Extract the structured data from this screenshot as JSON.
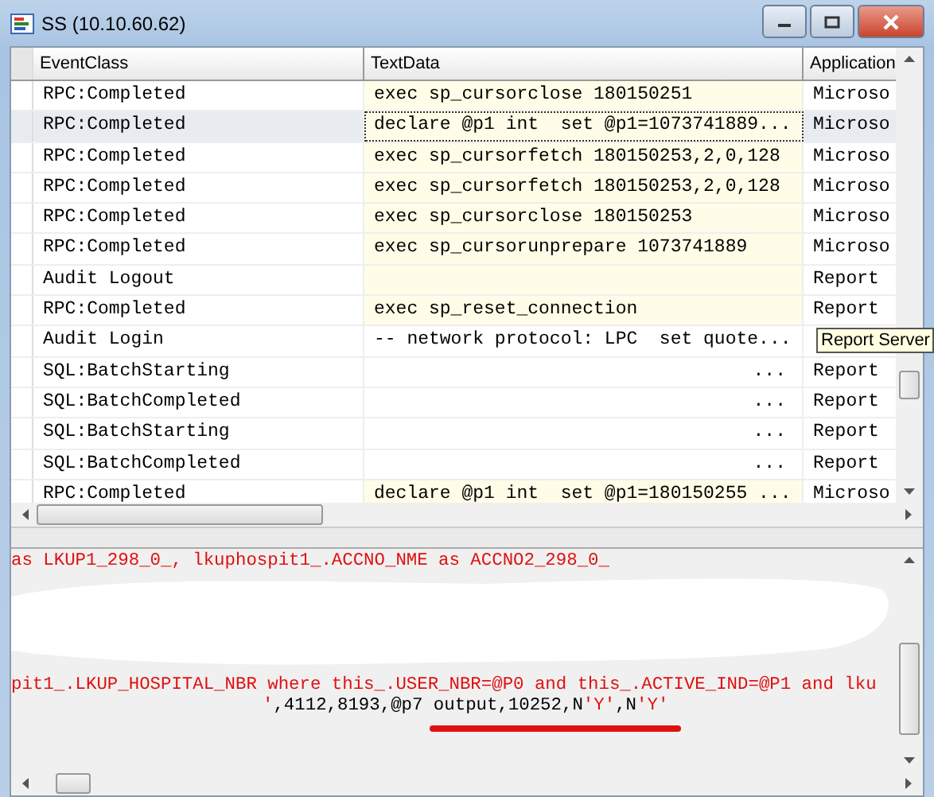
{
  "window": {
    "title": "SS (10.10.60.62)"
  },
  "table": {
    "columns": [
      "EventClass",
      "TextData",
      "Application"
    ],
    "rows": [
      {
        "event_class": "RPC:Completed",
        "text_data": "exec sp_cursorclose 180150251",
        "application": "Microso",
        "shaded": true,
        "selected": false
      },
      {
        "event_class": "RPC:Completed",
        "text_data": "declare @p1 int  set @p1=1073741889...",
        "application": "Microso",
        "shaded": true,
        "selected": true
      },
      {
        "event_class": "RPC:Completed",
        "text_data": "exec sp_cursorfetch 180150253,2,0,128",
        "application": "Microso",
        "shaded": true,
        "selected": false
      },
      {
        "event_class": "RPC:Completed",
        "text_data": "exec sp_cursorfetch 180150253,2,0,128",
        "application": "Microso",
        "shaded": true,
        "selected": false
      },
      {
        "event_class": "RPC:Completed",
        "text_data": "exec sp_cursorclose 180150253",
        "application": "Microso",
        "shaded": true,
        "selected": false
      },
      {
        "event_class": "RPC:Completed",
        "text_data": "exec sp_cursorunprepare 1073741889",
        "application": "Microso",
        "shaded": true,
        "selected": false
      },
      {
        "event_class": "Audit Logout",
        "application": "Report",
        "shaded": true,
        "selected": false
      },
      {
        "event_class": "RPC:Completed",
        "text_data": "exec sp_reset_connection",
        "application": "Report",
        "shaded": true,
        "selected": false
      },
      {
        "event_class": "Audit Login",
        "text_data": "-- network protocol: LPC  set quote...",
        "shaded": false,
        "selected": false
      },
      {
        "event_class": "SQL:BatchStarting",
        "text_data": "...",
        "application": "Report",
        "shaded": false,
        "selected": false
      },
      {
        "event_class": "SQL:BatchCompleted",
        "text_data": "...",
        "application": "Report",
        "shaded": false,
        "selected": false
      },
      {
        "event_class": "SQL:BatchStarting",
        "text_data": "...",
        "application": "Report",
        "shaded": false,
        "selected": false
      },
      {
        "event_class": "SQL:BatchCompleted",
        "text_data": "...",
        "application": "Report",
        "shaded": false,
        "selected": false
      },
      {
        "event_class": "RPC:Completed",
        "text_data": "declare @p1 int  set @p1=180150255 ...",
        "application": "Microso",
        "shaded": true,
        "selected": false
      }
    ]
  },
  "tooltip": "Report Server",
  "text_pane": {
    "lines": [
      [
        {
          "kind": "literal",
          "text": "as LKUP1_298_0_, lkuphospit1_.ACCNO_NME as ACCNO2_298_0_"
        }
      ],
      [
        {
          "kind": "literal",
          "text": "pit1_.LKUP_HOSPITAL_NBR where this_.USER_NBR=@P0 and this_.ACTIVE_IND=@P1 and lku"
        }
      ],
      [
        {
          "kind": "literal",
          "text": "'"
        },
        {
          "kind": "plain",
          "text": ",4112,8193,@p7 output,10252,N"
        },
        {
          "kind": "literal",
          "text": "'Y'"
        },
        {
          "kind": "plain",
          "text": ",N"
        },
        {
          "kind": "literal",
          "text": "'Y'"
        }
      ]
    ]
  }
}
